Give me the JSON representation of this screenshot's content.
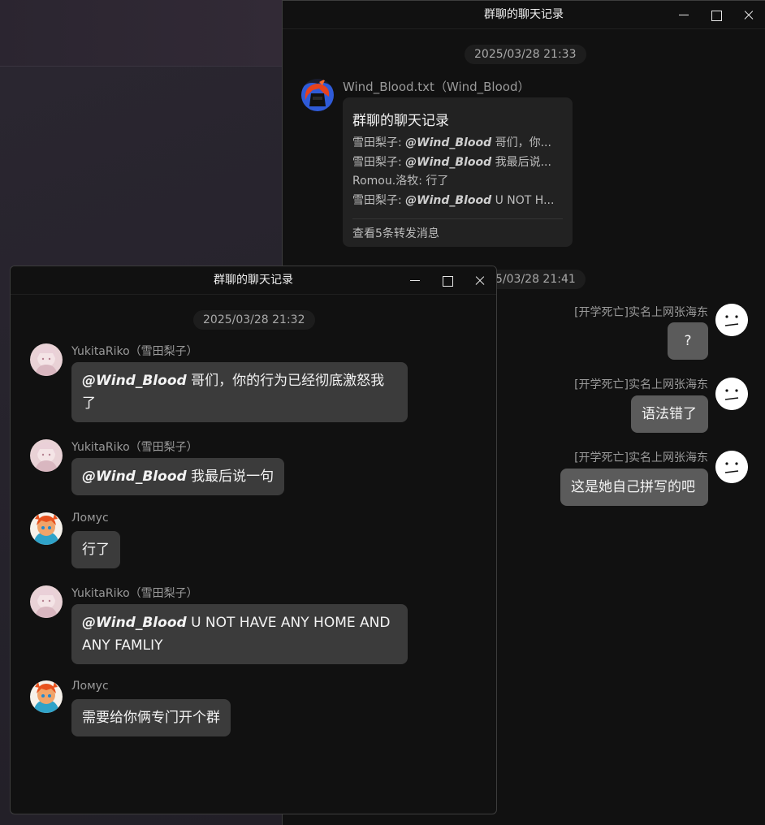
{
  "window_back": {
    "title": "群聊的聊天记录",
    "timestamp1": "2025/03/28 21:33",
    "timestamp2": "5/03/28 21:41",
    "forward_message": {
      "sender": "Wind_Blood.txt（Wind_Blood）",
      "card_title": "群聊的聊天记录",
      "lines": [
        {
          "prefix": "雪田梨子: ",
          "mention": "@Wind_Blood",
          "text": " 哥们，你..."
        },
        {
          "prefix": "雪田梨子: ",
          "mention": "@Wind_Blood",
          "text": " 我最后说..."
        },
        {
          "prefix": "Romou.洛牧: 行了",
          "mention": "",
          "text": ""
        },
        {
          "prefix": "雪田梨子: ",
          "mention": "@Wind_Blood",
          "text": " U NOT H..."
        }
      ],
      "footer": "查看5条转发消息"
    },
    "right_messages": [
      {
        "sender": "[开学死亡]实名上网张海东",
        "text": "?"
      },
      {
        "sender": "[开学死亡]实名上网张海东",
        "text": "语法错了"
      },
      {
        "sender": "[开学死亡]实名上网张海东",
        "text": "这是她自己拼写的吧"
      }
    ]
  },
  "window_front": {
    "title": "群聊的聊天记录",
    "timestamp": "2025/03/28 21:32",
    "messages": [
      {
        "sender": "YukitaRiko（雪田梨子）",
        "mention": "@Wind_Blood",
        "text": " 哥们，你的行为已经彻底激怒我了"
      },
      {
        "sender": "YukitaRiko（雪田梨子）",
        "mention": "@Wind_Blood",
        "text": " 我最后说一句"
      },
      {
        "sender": "Ломус",
        "mention": "",
        "text": "行了"
      },
      {
        "sender": "YukitaRiko（雪田梨子）",
        "mention": "@Wind_Blood",
        "text": " U NOT HAVE ANY HOME AND ANY FAMLIY"
      },
      {
        "sender": "Ломус",
        "mention": "",
        "text": "需要给你俩专门开个群"
      }
    ]
  },
  "icons": {
    "minimize": "minimize-icon",
    "maximize": "maximize-icon",
    "close": "close-icon"
  },
  "colors": {
    "window_bg": "#111111",
    "bubble_left": "#3b3b3b",
    "bubble_right": "#5b5b5b",
    "card_bg": "#222222",
    "meta_text": "#9a9a9a"
  }
}
